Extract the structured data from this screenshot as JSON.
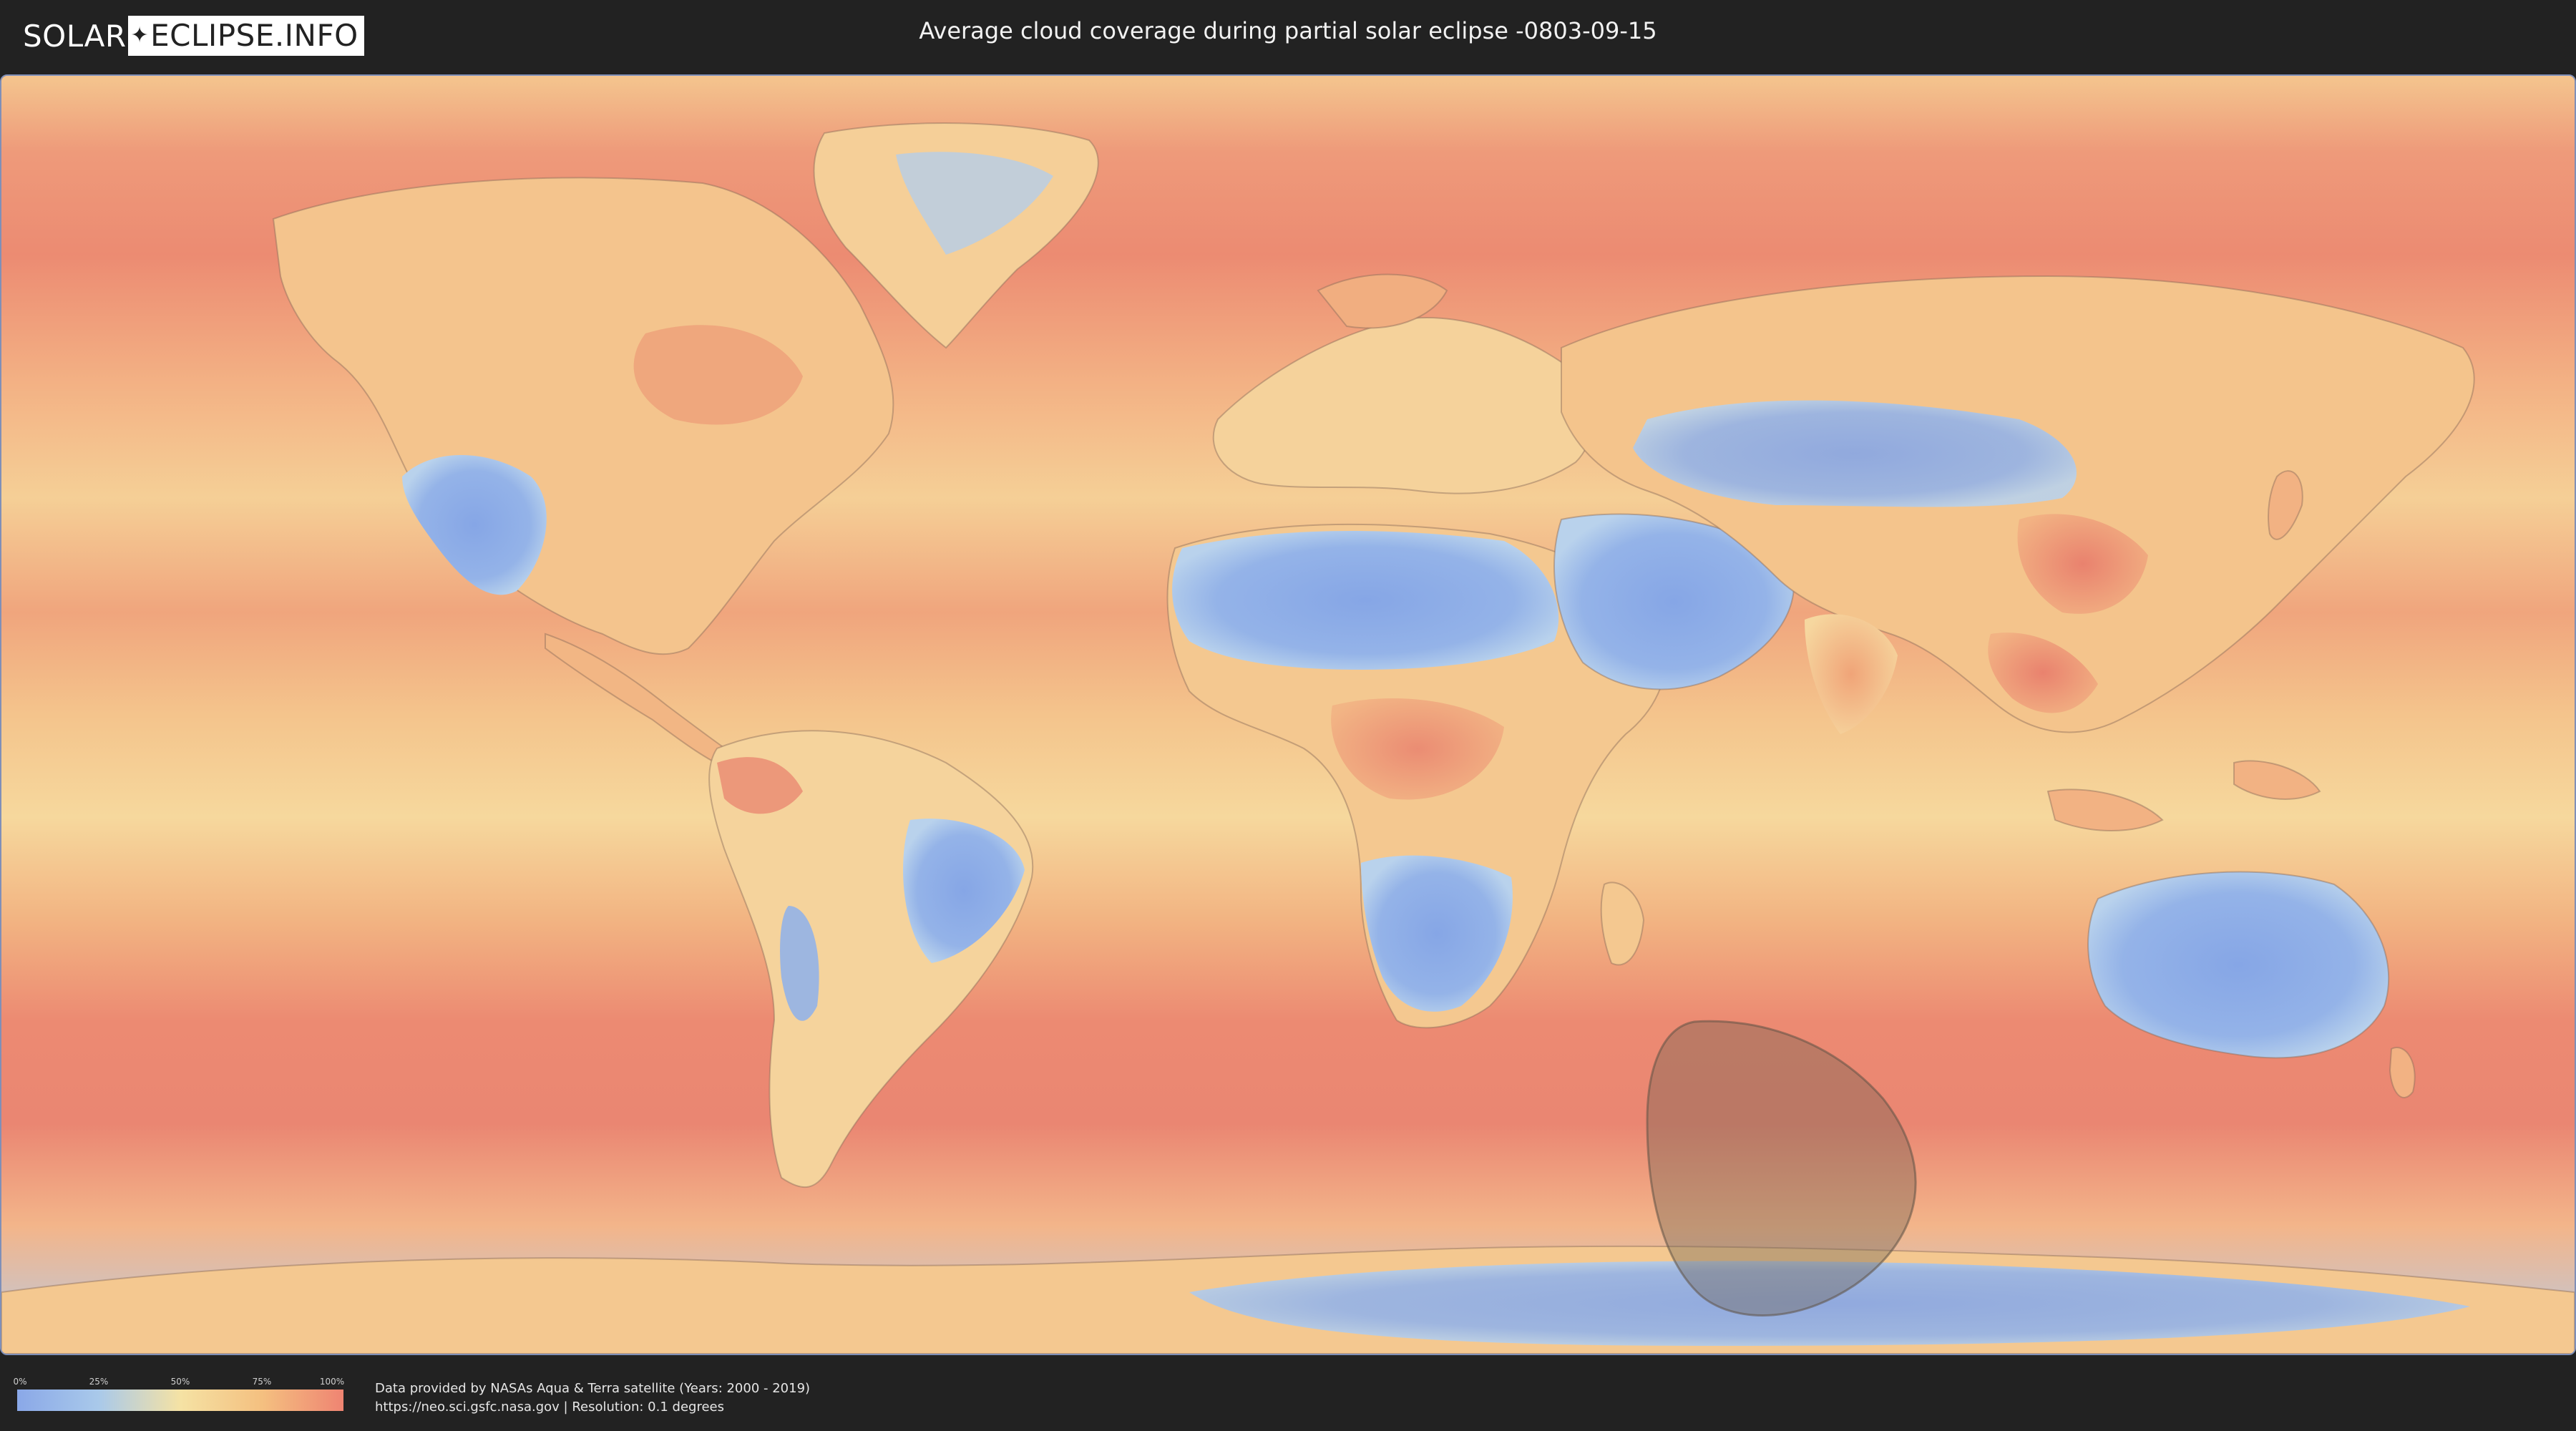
{
  "header": {
    "logo": {
      "part1": "SOLAR",
      "part2": "ECLIPSE.INFO"
    },
    "title": "Average cloud coverage during partial solar eclipse -0803-09-15"
  },
  "map": {
    "layer": "average cloud coverage",
    "colors": {
      "ocean_cloudy": "#ee8b76",
      "ocean_mid": "#f3c287",
      "land_clear": "#8aa8e8",
      "land_mid": "#f5e0a6",
      "eclipse_shadow": "#7a6a58"
    }
  },
  "legend": {
    "ticks": [
      "0%",
      "25%",
      "50%",
      "75%",
      "100%"
    ],
    "colors": [
      "#8aa8e8",
      "#a9c9ea",
      "#f5e2a4",
      "#f4c080",
      "#ef8472"
    ]
  },
  "credits": {
    "line1": "Data provided by NASAs Aqua & Terra satellite (Years: 2000 - 2019)",
    "line2": "https://neo.sci.gsfc.nasa.gov | Resolution: 0.1 degrees"
  }
}
